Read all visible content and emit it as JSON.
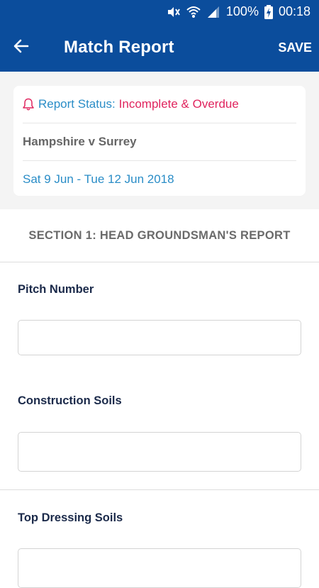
{
  "status_bar": {
    "battery": "100%",
    "time": "00:18",
    "icons": [
      "mute-icon",
      "wifi-icon",
      "signal-icon",
      "battery-charging-icon"
    ]
  },
  "app_bar": {
    "back_icon": "arrow-left-icon",
    "title": "Match Report",
    "save_label": "SAVE"
  },
  "report_card": {
    "status_icon": "bell-icon",
    "status_label": "Report Status:",
    "status_value": "Incomplete & Overdue",
    "match": "Hampshire v Surrey",
    "dates": "Sat 9 Jun - Tue 12 Jun 2018"
  },
  "section": {
    "title": "SECTION 1: HEAD GROUNDSMAN'S REPORT"
  },
  "fields": [
    {
      "label": "Pitch Number",
      "value": ""
    },
    {
      "label": "Construction Soils",
      "value": ""
    },
    {
      "label": "Top Dressing Soils",
      "value": ""
    }
  ],
  "colors": {
    "primary": "#0b4d9c",
    "accent": "#2a8dc7",
    "alert": "#e0245e"
  }
}
